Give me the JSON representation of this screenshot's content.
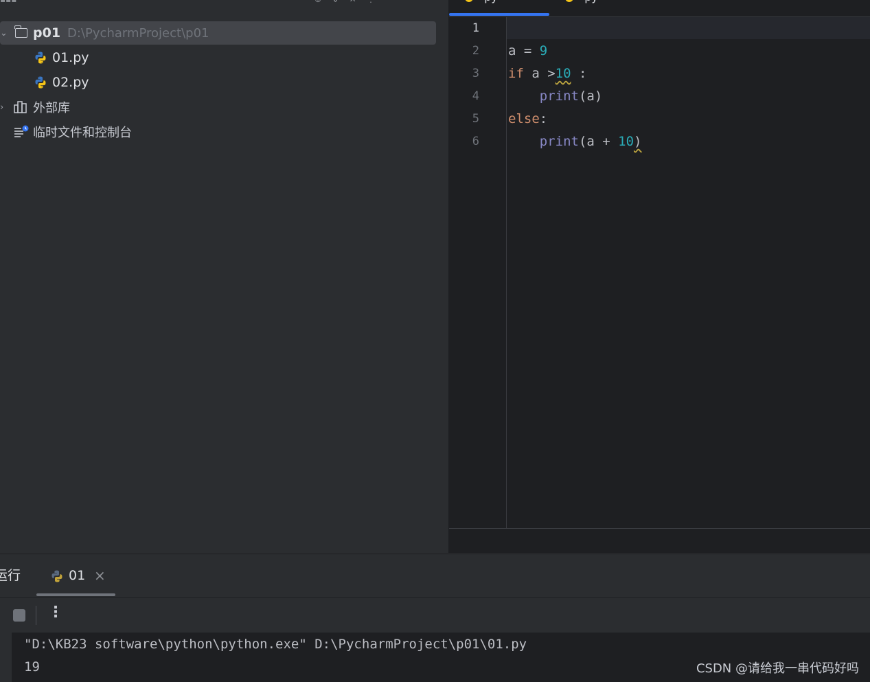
{
  "project": {
    "root_name": "p01",
    "root_path": "D:\\PycharmProject\\p01",
    "files": [
      {
        "name": "01.py",
        "icon": "python-file-icon"
      },
      {
        "name": "02.py",
        "icon": "python-file-icon"
      }
    ],
    "external_libraries": "外部库",
    "scratches": "临时文件和控制台"
  },
  "editor": {
    "current_line": 1,
    "line_numbers": [
      "1",
      "2",
      "3",
      "4",
      "5",
      "6"
    ],
    "code": {
      "l2": {
        "var": "a",
        "op": " = ",
        "num": "9"
      },
      "l3": {
        "kw": "if",
        "mid": " a >",
        "num": "10",
        "tail": " :"
      },
      "l4": {
        "fn": "print",
        "args": "(a)"
      },
      "l5": {
        "kw": "else",
        "tail": ":"
      },
      "l6": {
        "fn": "print",
        "open": "(a + ",
        "num": "10",
        "close": ")"
      }
    }
  },
  "run": {
    "title": "运行",
    "tab_label": "01",
    "console_lines": [
      "\"D:\\KB23 software\\python\\python.exe\" D:\\PycharmProject\\p01\\01.py",
      "19"
    ]
  },
  "watermark": "CSDN @请给我一串代码好吗",
  "colors": {
    "background": "#2b2d30",
    "editor_bg": "#1e1f22",
    "keyword": "#cf8e6d",
    "number": "#2aacb8",
    "builtin": "#8888c6",
    "accent": "#3574f0"
  }
}
